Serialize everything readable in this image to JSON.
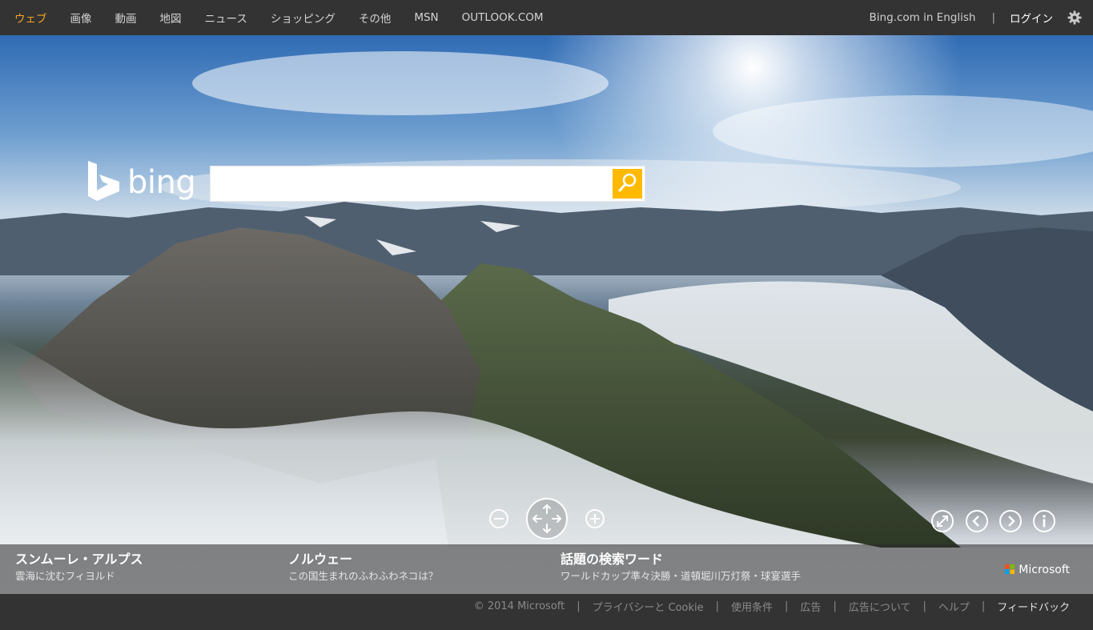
{
  "topnav": {
    "items": [
      "ウェブ",
      "画像",
      "動画",
      "地図",
      "ニュース",
      "ショッピング",
      "その他",
      "MSN",
      "OUTLOOK.COM"
    ],
    "active_index": 0
  },
  "topright": {
    "english_link": "Bing.com in English",
    "separator": "|",
    "login": "ログイン",
    "settings_icon": "gear-icon"
  },
  "logo": {
    "text": "bing",
    "icon": "bing-b-logo-icon"
  },
  "search": {
    "value": "",
    "placeholder": "",
    "button_icon": "search-icon",
    "accent": "#ffb900"
  },
  "viewer_controls": {
    "zoom_out_icon": "zoom-out-icon",
    "pan_icon": "pan-arrows-icon",
    "zoom_in_icon": "zoom-in-icon",
    "fullscreen_icon": "expand-icon",
    "prev_icon": "chevron-left-icon",
    "next_icon": "chevron-right-icon",
    "info_icon": "info-icon"
  },
  "captions": [
    {
      "title": "スンムーレ・アルプス",
      "subtitle": "雲海に沈むフィヨルド"
    },
    {
      "title": "ノルウェー",
      "subtitle": "この国生まれのふわふわネコは？"
    },
    {
      "title": "話題の検索ワード",
      "subtitle": "ワールドカップ準々決勝・道頓堀川万灯祭・球宴選手"
    }
  ],
  "brand": {
    "name": "Microsoft"
  },
  "footer": {
    "links": [
      "© 2014 Microsoft",
      "プライバシーと Cookie",
      "使用条件",
      "広告",
      "広告について",
      "ヘルプ",
      "フィードバック"
    ],
    "separator": "|"
  },
  "colors": {
    "active_nav": "#f5a623",
    "topbar": "#333333",
    "search_button": "#ffb900"
  }
}
